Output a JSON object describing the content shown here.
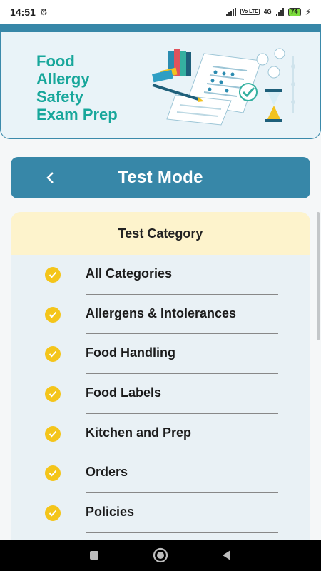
{
  "status_bar": {
    "time": "14:51",
    "network_label": "Vo LTE",
    "network_gen": "4G",
    "battery": "74"
  },
  "header": {
    "title_lines": [
      "Food",
      "Allergy",
      "Safety",
      "Exam Prep"
    ]
  },
  "mode_bar": {
    "title": "Test Mode",
    "back_icon": "chevron-left-icon"
  },
  "category": {
    "header": "Test Category",
    "items": [
      {
        "label": "All Categories",
        "checked": true
      },
      {
        "label": "Allergens & Intolerances",
        "checked": true
      },
      {
        "label": "Food Handling",
        "checked": true
      },
      {
        "label": "Food Labels",
        "checked": true
      },
      {
        "label": "Kitchen and Prep",
        "checked": true
      },
      {
        "label": "Orders",
        "checked": true
      },
      {
        "label": "Policies",
        "checked": true
      },
      {
        "label": "",
        "checked": false
      }
    ]
  },
  "nav_bar": {
    "recents_icon": "square-icon",
    "home_icon": "circle-home-icon",
    "back_icon": "triangle-back-icon"
  },
  "colors": {
    "primary": "#3787a8",
    "title_teal": "#18a79b",
    "check_yellow": "#f4c51a",
    "category_header_bg": "#fdf3cc",
    "panel_bg": "#e9f1f5"
  }
}
